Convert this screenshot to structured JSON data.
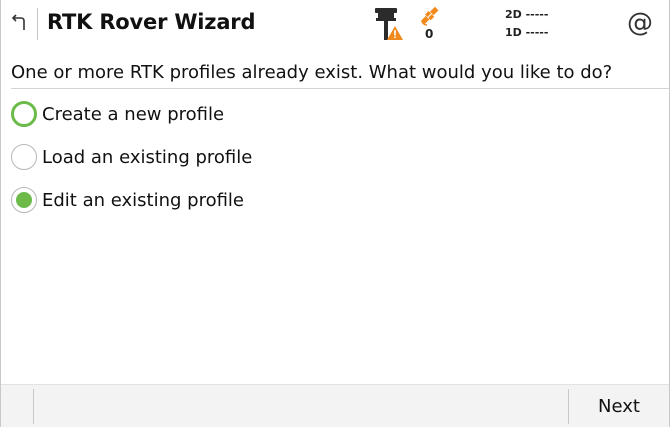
{
  "header": {
    "title": "RTK Rover Wizard",
    "satellite_count": "0",
    "precision_2d": "2D -----",
    "precision_1d": "1D -----",
    "at_symbol": "@",
    "icons": {
      "back": "back-arrow-icon",
      "receiver": "gnss-receiver-warning-icon",
      "satellite": "satellite-icon",
      "at": "at-icon"
    },
    "warning_color": "#f08a1c",
    "satellite_color": "#f08a1c"
  },
  "question": "One or more RTK profiles already exist.  What would you like to do?",
  "options": [
    {
      "label": "Create a new profile",
      "state": "focused"
    },
    {
      "label": "Load an existing profile",
      "state": "unselected"
    },
    {
      "label": "Edit an existing profile",
      "state": "selected"
    }
  ],
  "accent_color": "#6cbb4a",
  "footer": {
    "next_label": "Next"
  }
}
